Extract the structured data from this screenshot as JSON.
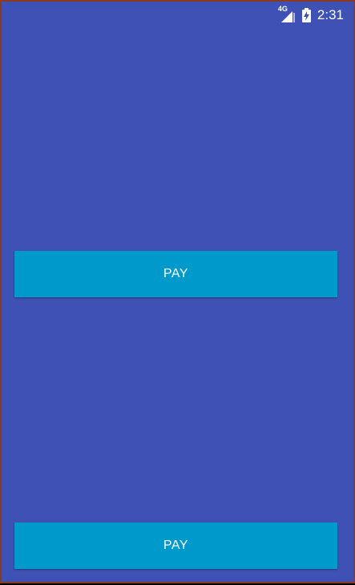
{
  "status_bar": {
    "network_label": "4G",
    "signal_icon": "cell-signal-icon",
    "battery_icon": "battery-charging-icon",
    "time": "2:31"
  },
  "buttons": {
    "top_pay_label": "PAY",
    "bottom_pay_label": "PAY"
  },
  "colors": {
    "background": "#3F51B5",
    "button": "#0099CC",
    "text": "#FFFFFF"
  }
}
